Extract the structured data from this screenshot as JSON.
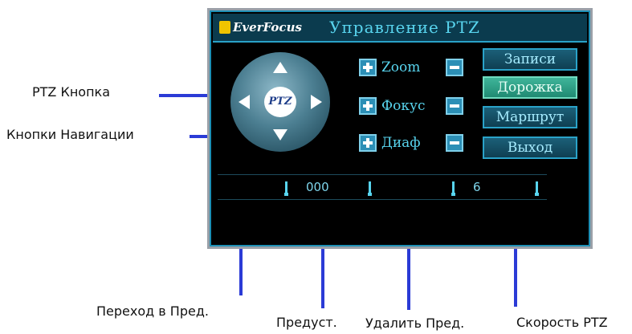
{
  "osd": {
    "brand": "EverFocus",
    "title": "Управление PTZ",
    "joystick": {
      "center_label": "PTZ",
      "arrows": [
        "arrow-up-icon",
        "arrow-down-icon",
        "arrow-left-icon",
        "arrow-right-icon"
      ]
    },
    "controls": [
      {
        "label": "Zoom"
      },
      {
        "label": "Фокус"
      },
      {
        "label": "Диаф"
      }
    ],
    "menu": [
      {
        "label": "Записи",
        "active": false
      },
      {
        "label": "Дорожка",
        "active": true
      },
      {
        "label": "Маршрут",
        "active": false
      },
      {
        "label": "Выход",
        "active": false
      }
    ],
    "preset_value": "000",
    "speed_value": "6"
  },
  "callouts": {
    "ptz_button": "PTZ Кнопка",
    "nav_buttons": "Кнопки Навигации",
    "goto_preset": "Переход в Пред.",
    "preset": "Предуст.",
    "delete_preset": "Удалить Пред.",
    "ptz_speed": "Скорость PTZ"
  },
  "colors": {
    "leader_line": "#2b3bd6",
    "osd_text": "#58d4ee",
    "active_button": "#3fb59a"
  }
}
